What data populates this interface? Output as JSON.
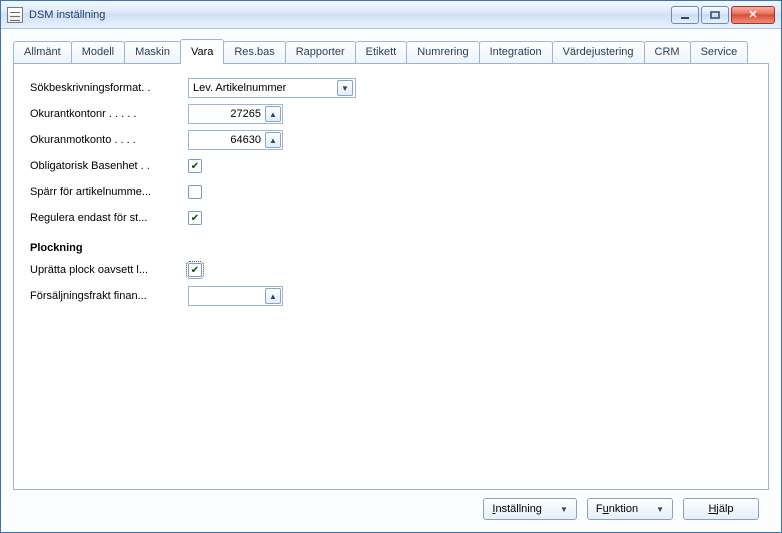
{
  "window": {
    "title": "DSM inställning"
  },
  "tabs": [
    {
      "label": "Allmänt"
    },
    {
      "label": "Modell"
    },
    {
      "label": "Maskin"
    },
    {
      "label": "Vara"
    },
    {
      "label": "Res.bas"
    },
    {
      "label": "Rapporter"
    },
    {
      "label": "Etikett"
    },
    {
      "label": "Numrering"
    },
    {
      "label": "Integration"
    },
    {
      "label": "Värdejustering"
    },
    {
      "label": "CRM"
    },
    {
      "label": "Service"
    }
  ],
  "active_tab_index": 3,
  "fields": {
    "sokbeskriv": {
      "label": "Sökbeskrivningsformat. .",
      "value": "Lev. Artikelnummer"
    },
    "okurantkontonr": {
      "label": "Okurantkontonr .  .  .  .  .",
      "value": "27265"
    },
    "okuranmotkonto": {
      "label": "Okuranmotkonto  .  .  .  .",
      "value": "64630"
    },
    "obligatorisk": {
      "label": "Obligatorisk Basenhet .  .",
      "checked": true
    },
    "sparr": {
      "label": "Spärr för artikelnumme...",
      "checked": false
    },
    "regulera": {
      "label": "Regulera endast för st...",
      "checked": true
    }
  },
  "section": {
    "title": "Plockning"
  },
  "plock": {
    "upratta": {
      "label": "Uprätta plock oavsett l...",
      "checked": true
    },
    "frakt": {
      "label": "Försäljningsfrakt finan...",
      "value": ""
    }
  },
  "footer": {
    "installning": "Inställning",
    "funktion": "Funktion",
    "hjalp": "Hjälp"
  }
}
